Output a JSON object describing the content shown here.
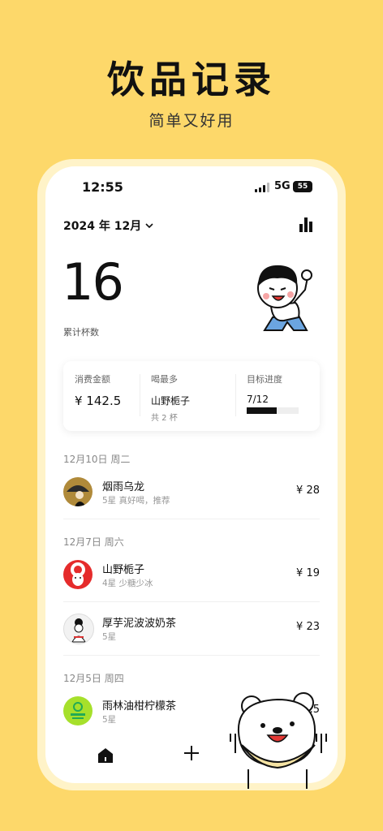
{
  "hero": {
    "title": "饮品记录",
    "subtitle": "简单又好用"
  },
  "status": {
    "time": "12:55",
    "network": "5G",
    "battery": "55"
  },
  "header": {
    "month": "2024 年 12月",
    "chevron": "chevron-down-icon",
    "stats_icon": "bar-chart-icon"
  },
  "summary": {
    "count": "16",
    "count_label": "累计杯数"
  },
  "card": {
    "spend_label": "消费金额",
    "spend_value": "¥ 142.5",
    "top_label": "喝最多",
    "top_value": "山野栀子",
    "top_sub": "共 2 杯",
    "goal_label": "目标进度",
    "goal_value": "7/12",
    "goal_fraction": 0.5833
  },
  "days": [
    {
      "date": "12月10日 周二",
      "items": [
        {
          "name": "烟雨乌龙",
          "note": "5星 真好喝，推荐",
          "price": "¥ 28",
          "avatar": "lady-with-umbrella-logo"
        }
      ]
    },
    {
      "date": "12月7日 周六",
      "items": [
        {
          "name": "山野栀子",
          "note": "4星 少糖少冰",
          "price": "¥ 19",
          "avatar": "opera-mask-logo"
        },
        {
          "name": "厚芋泥波波奶茶",
          "note": "5星",
          "price": "¥ 23",
          "avatar": "ink-lady-logo"
        }
      ]
    },
    {
      "date": "12月5日 周四",
      "items": [
        {
          "name": "雨林油柑柠檬茶",
          "note": "5星",
          "price": "¥ 6.5",
          "avatar": "green-brand-logo"
        }
      ]
    }
  ],
  "nav": {
    "home": "home-icon",
    "add": "plus-icon"
  },
  "colors": {
    "background": "#FDD86A",
    "frame": "#FFF3C8",
    "avatar_gold": "#B08A3A",
    "avatar_red": "#E52B2B",
    "avatar_green": "#A6E02B"
  }
}
